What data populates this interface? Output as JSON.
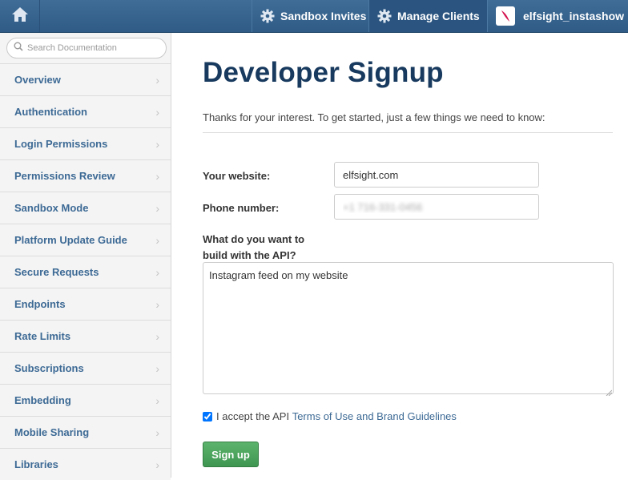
{
  "topbar": {
    "home_icon": "home-icon",
    "sandbox_invites_label": "Sandbox Invites",
    "manage_clients_label": "Manage Clients",
    "username": "elfsight_instashow"
  },
  "sidebar": {
    "search_placeholder": "Search Documentation",
    "items": [
      {
        "label": "Overview"
      },
      {
        "label": "Authentication"
      },
      {
        "label": "Login Permissions"
      },
      {
        "label": "Permissions Review"
      },
      {
        "label": "Sandbox Mode"
      },
      {
        "label": "Platform Update Guide"
      },
      {
        "label": "Secure Requests"
      },
      {
        "label": "Endpoints"
      },
      {
        "label": "Rate Limits"
      },
      {
        "label": "Subscriptions"
      },
      {
        "label": "Embedding"
      },
      {
        "label": "Mobile Sharing"
      },
      {
        "label": "Libraries"
      }
    ]
  },
  "main": {
    "title": "Developer Signup",
    "intro": "Thanks for your interest. To get started, just a few things we need to know:",
    "website_label": "Your website:",
    "website_value": "elfsight.com",
    "phone_label": "Phone number:",
    "phone_value": "+1 716-331-0456",
    "question_label": "What do you want to build with the API?",
    "question_value": "Instagram feed on my website",
    "accept_prefix": "I accept the API",
    "accept_link": "Terms of Use and Brand Guidelines",
    "accept_checked": true,
    "signup_label": "Sign up"
  },
  "colors": {
    "topbar": "#2f5b86",
    "title": "#183a5e",
    "link": "#3d6a95",
    "signup_button": "#4ca35e"
  }
}
